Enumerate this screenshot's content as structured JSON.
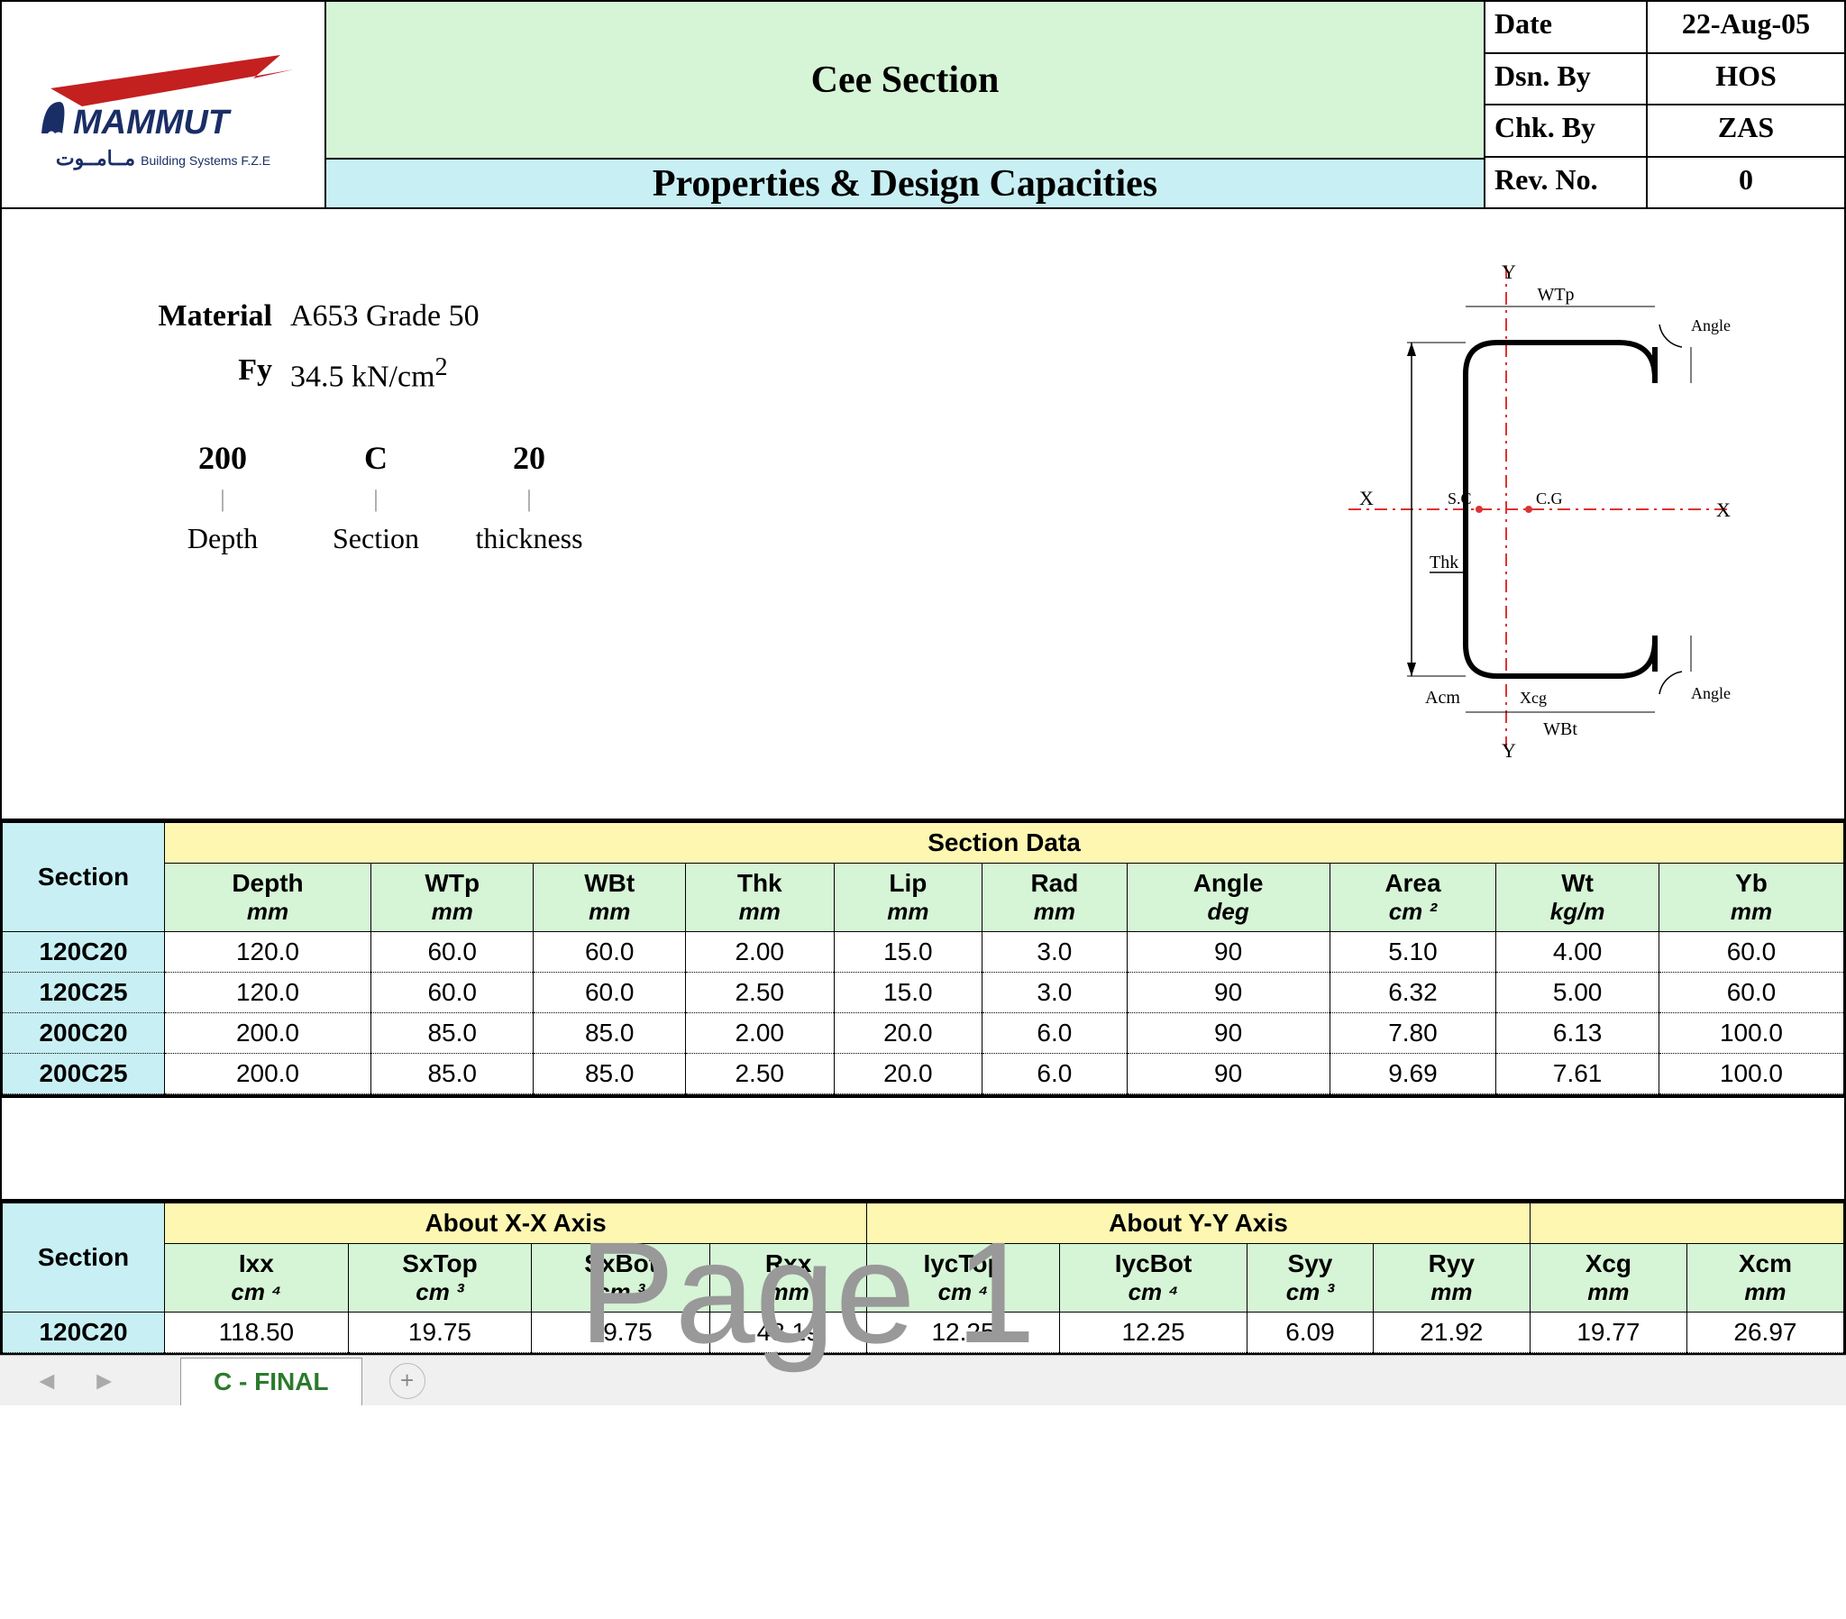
{
  "header": {
    "title_top": "Cee Section",
    "title_bottom": "Properties & Design Capacities",
    "logo_main": "MAMMUT",
    "logo_sub": "Building Systems F.Z.E",
    "logo_arabic": "مــامــوت"
  },
  "info": {
    "date_label": "Date",
    "date_value": "22-Aug-05",
    "dsn_label": "Dsn. By",
    "dsn_value": "HOS",
    "chk_label": "Chk. By",
    "chk_value": "ZAS",
    "rev_label": "Rev. No.",
    "rev_value": "0"
  },
  "material": {
    "material_label": "Material",
    "material_value": "A653 Grade 50",
    "fy_label": "Fy",
    "fy_value": "34.5 kN/cm",
    "fy_exp": "2",
    "designation": {
      "col1_top": "200",
      "col1_bottom": "Depth",
      "col2_top": "C",
      "col2_bottom": "Section",
      "col3_top": "20",
      "col3_bottom": "thickness"
    }
  },
  "diagram_labels": {
    "Y": "Y",
    "X": "X",
    "CG": "C.G",
    "SC": "S.C",
    "WTp": "WTp",
    "WBt": "WBt",
    "Thk": "Thk",
    "Angle": "Angle",
    "Acm": "Acm",
    "Xcg": "Xcg"
  },
  "table1": {
    "group_header": "Section Data",
    "section_header": "Section",
    "columns": [
      {
        "name": "Depth",
        "unit": "mm"
      },
      {
        "name": "WTp",
        "unit": "mm"
      },
      {
        "name": "WBt",
        "unit": "mm"
      },
      {
        "name": "Thk",
        "unit": "mm"
      },
      {
        "name": "Lip",
        "unit": "mm"
      },
      {
        "name": "Rad",
        "unit": "mm"
      },
      {
        "name": "Angle",
        "unit": "deg"
      },
      {
        "name": "Area",
        "unit": "cm ²"
      },
      {
        "name": "Wt",
        "unit": "kg/m"
      },
      {
        "name": "Yb",
        "unit": "mm"
      }
    ],
    "rows": [
      {
        "section": "120C20",
        "v": [
          "120.0",
          "60.0",
          "60.0",
          "2.00",
          "15.0",
          "3.0",
          "90",
          "5.10",
          "4.00",
          "60.0"
        ]
      },
      {
        "section": "120C25",
        "v": [
          "120.0",
          "60.0",
          "60.0",
          "2.50",
          "15.0",
          "3.0",
          "90",
          "6.32",
          "5.00",
          "60.0"
        ]
      },
      {
        "section": "200C20",
        "v": [
          "200.0",
          "85.0",
          "85.0",
          "2.00",
          "20.0",
          "6.0",
          "90",
          "7.80",
          "6.13",
          "100.0"
        ]
      },
      {
        "section": "200C25",
        "v": [
          "200.0",
          "85.0",
          "85.0",
          "2.50",
          "20.0",
          "6.0",
          "90",
          "9.69",
          "7.61",
          "100.0"
        ]
      }
    ]
  },
  "table2": {
    "section_header": "Section",
    "group_xx": "About X-X Axis",
    "group_yy": "About Y-Y Axis",
    "columns": [
      {
        "name": "Ixx",
        "unit": "cm ⁴"
      },
      {
        "name": "SxTop",
        "unit": "cm ³"
      },
      {
        "name": "SxBot",
        "unit": "cm ³"
      },
      {
        "name": "Rxx",
        "unit": "mm"
      },
      {
        "name": "IycTop",
        "unit": "cm ⁴"
      },
      {
        "name": "IycBot",
        "unit": "cm ⁴"
      },
      {
        "name": "Syy",
        "unit": "cm ³"
      },
      {
        "name": "Ryy",
        "unit": "mm"
      },
      {
        "name": "Xcg",
        "unit": "mm"
      },
      {
        "name": "Xcm",
        "unit": "mm"
      }
    ],
    "rows": [
      {
        "section": "120C20",
        "v": [
          "118.50",
          "19.75",
          "19.75",
          "48.19",
          "12.25",
          "12.25",
          "6.09",
          "21.92",
          "19.77",
          "26.97"
        ]
      }
    ]
  },
  "watermark": "Page 1",
  "tabs": {
    "active": "C - FINAL",
    "add": "+"
  }
}
